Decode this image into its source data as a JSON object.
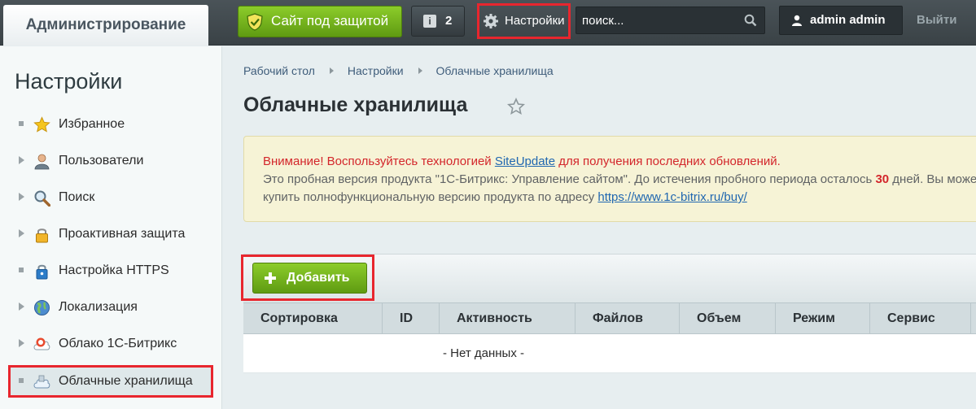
{
  "topbar": {
    "admin_tab": "Администрирование",
    "secure_label": "Сайт под защитой",
    "notifications_count": "2",
    "notifications_icon_glyph": "i",
    "settings_label": "Настройки",
    "search_placeholder": "поиск...",
    "user_name": "admin admin",
    "logout_label": "Выйти"
  },
  "sidebar": {
    "title": "Настройки",
    "items": [
      {
        "label": "Избранное",
        "icon": "star-icon",
        "marker": "square"
      },
      {
        "label": "Пользователи",
        "icon": "user-icon",
        "marker": "arrow"
      },
      {
        "label": "Поиск",
        "icon": "magnifier-icon",
        "marker": "arrow"
      },
      {
        "label": "Проактивная защита",
        "icon": "lock-icon",
        "marker": "arrow"
      },
      {
        "label": "Настройка HTTPS",
        "icon": "https-lock-icon",
        "marker": "square"
      },
      {
        "label": "Локализация",
        "icon": "globe-icon",
        "marker": "arrow"
      },
      {
        "label": "Облако 1С-Битрикс",
        "icon": "bitrix-cloud-icon",
        "marker": "arrow"
      },
      {
        "label": "Облачные хранилища",
        "icon": "cloud-storage-icon",
        "marker": "square",
        "active": true
      }
    ]
  },
  "breadcrumb": [
    "Рабочий стол",
    "Настройки",
    "Облачные хранилища"
  ],
  "page_title": "Облачные хранилища",
  "notice": {
    "warning_prefix": "Внимание! Воспользуйтесь технологией ",
    "siteupdate_link": "SiteUpdate",
    "warning_suffix": " для получения последних обновлений.",
    "trial_text": "Это пробная версия продукта \"1С-Битрикс: Управление сайтом\". До истечения пробного периода осталось ",
    "days": "30",
    "days_suffix": " дней. Вы можете",
    "buy_text": "купить полнофункциональную версию продукта по адресу ",
    "buy_link": "https://www.1c-bitrix.ru/buy/"
  },
  "toolbar": {
    "add_label": "Добавить"
  },
  "table": {
    "columns": [
      "Сортировка",
      "ID",
      "Активность",
      "Файлов",
      "Объем",
      "Режим",
      "Сервис"
    ],
    "empty_text": "- Нет данных -"
  },
  "colors": {
    "accent_green": "#6aab17",
    "highlight_red": "#e8262e",
    "topbar_dark": "#3e474b",
    "link_blue": "#2067b0"
  }
}
